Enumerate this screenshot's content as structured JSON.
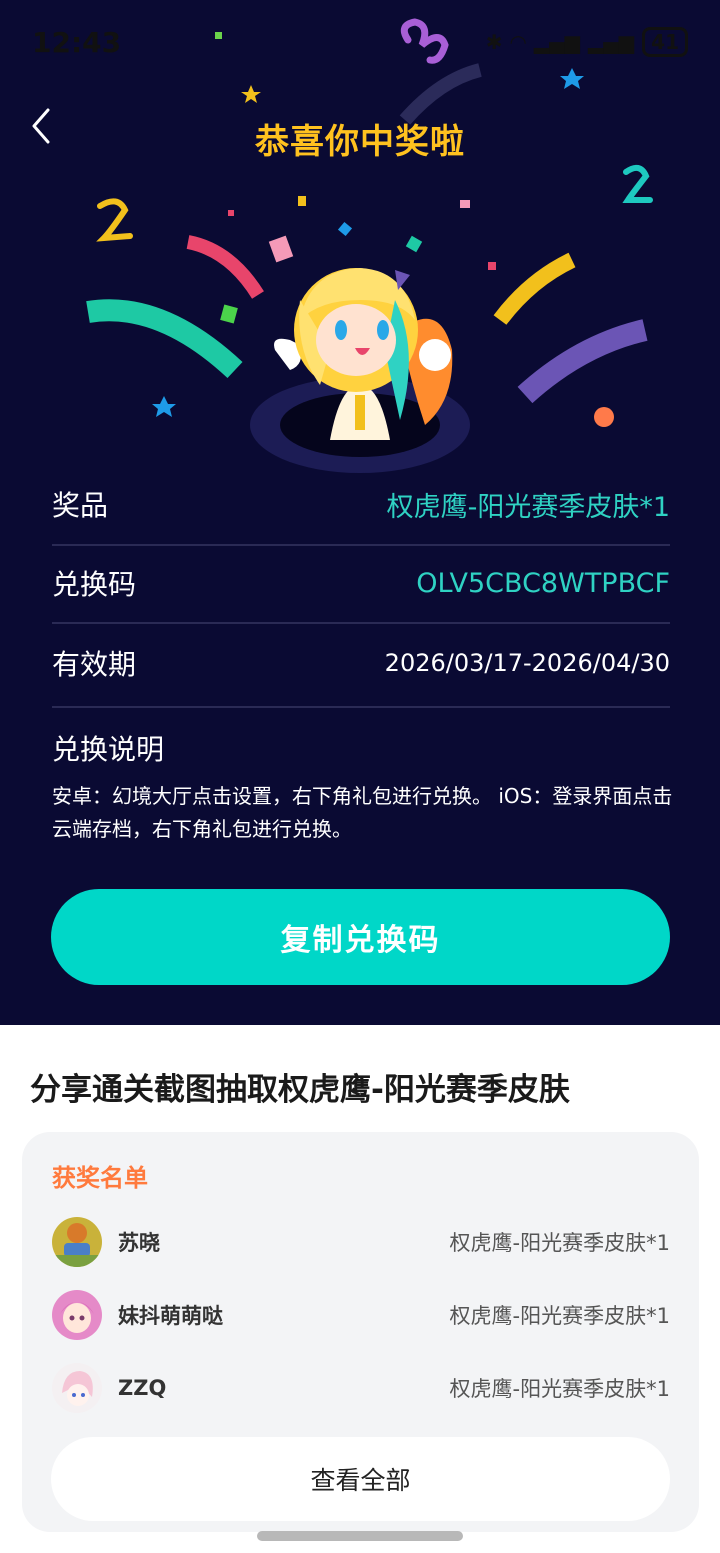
{
  "status_bar": {
    "time": "12:43",
    "battery": "41"
  },
  "header": {
    "title": "恭喜你中奖啦"
  },
  "prize": {
    "prize_label": "奖品",
    "prize_value": "权虎鹰-阳光赛季皮肤*1",
    "code_label": "兑换码",
    "code_value": "OLV5CBC8WTPBCF",
    "validity_label": "有效期",
    "validity_value": "2026/03/17-2026/04/30",
    "instructions_label": "兑换说明",
    "instructions_text": "安卓：幻境大厅点击设置，右下角礼包进行兑换。 iOS：登录界面点击云端存档，右下角礼包进行兑换。"
  },
  "copy_button": {
    "label": "复制兑换码"
  },
  "share": {
    "title": "分享通关截图抽取权虎鹰-阳光赛季皮肤"
  },
  "winners": {
    "title": "获奖名单",
    "items": [
      {
        "name": "苏晓",
        "prize": "权虎鹰-阳光赛季皮肤*1"
      },
      {
        "name": "妹抖萌萌哒",
        "prize": "权虎鹰-阳光赛季皮肤*1"
      },
      {
        "name": "ZZQ",
        "prize": "权虎鹰-阳光赛季皮肤*1"
      }
    ],
    "view_all_label": "查看全部"
  },
  "colors": {
    "background": "#0a0a33",
    "accent": "#00d7c8",
    "title": "#ffc21f",
    "winners_title": "#ff7a3d"
  }
}
